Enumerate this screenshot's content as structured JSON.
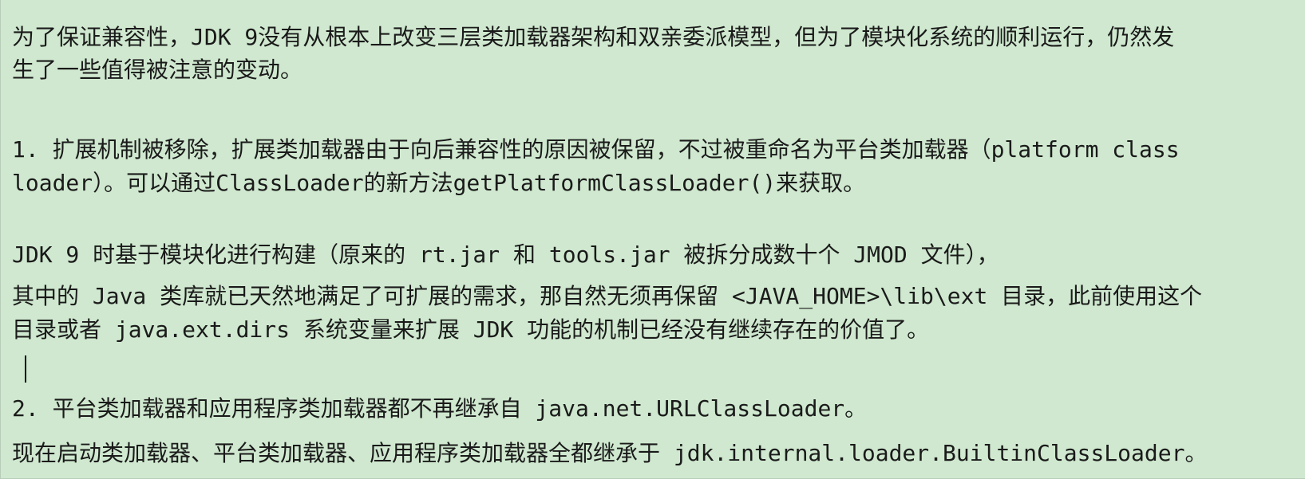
{
  "document": {
    "lines": [
      "为了保证兼容性，JDK 9没有从根本上改变三层类加载器架构和双亲委派模型，但为了模块化系统的顺利运行，仍然发",
      "生了一些值得被注意的变动。",
      "1. 扩展机制被移除，扩展类加载器由于向后兼容性的原因被保留，不过被重命名为平台类加载器（platform class",
      "loader）。可以通过ClassLoader的新方法getPlatformClassLoader()来获取。",
      "JDK 9 时基于模块化进行构建（原来的 rt.jar 和 tools.jar 被拆分成数十个 JMOD 文件），",
      "其中的 Java 类库就已天然地满足了可扩展的需求，那自然无须再保留 <JAVA_HOME>\\lib\\ext 目录，此前使用这个",
      "目录或者 java.ext.dirs 系统变量来扩展 JDK 功能的机制已经没有继续存在的价值了。",
      "2. 平台类加载器和应用程序类加载器都不再继承自 java.net.URLClassLoader。",
      "现在启动类加载器、平台类加载器、应用程序类加载器全都继承于 jdk.internal.loader.BuiltinClassLoader。"
    ]
  },
  "colors": {
    "background": "#cfe8cf",
    "text": "#1a1a1a"
  }
}
